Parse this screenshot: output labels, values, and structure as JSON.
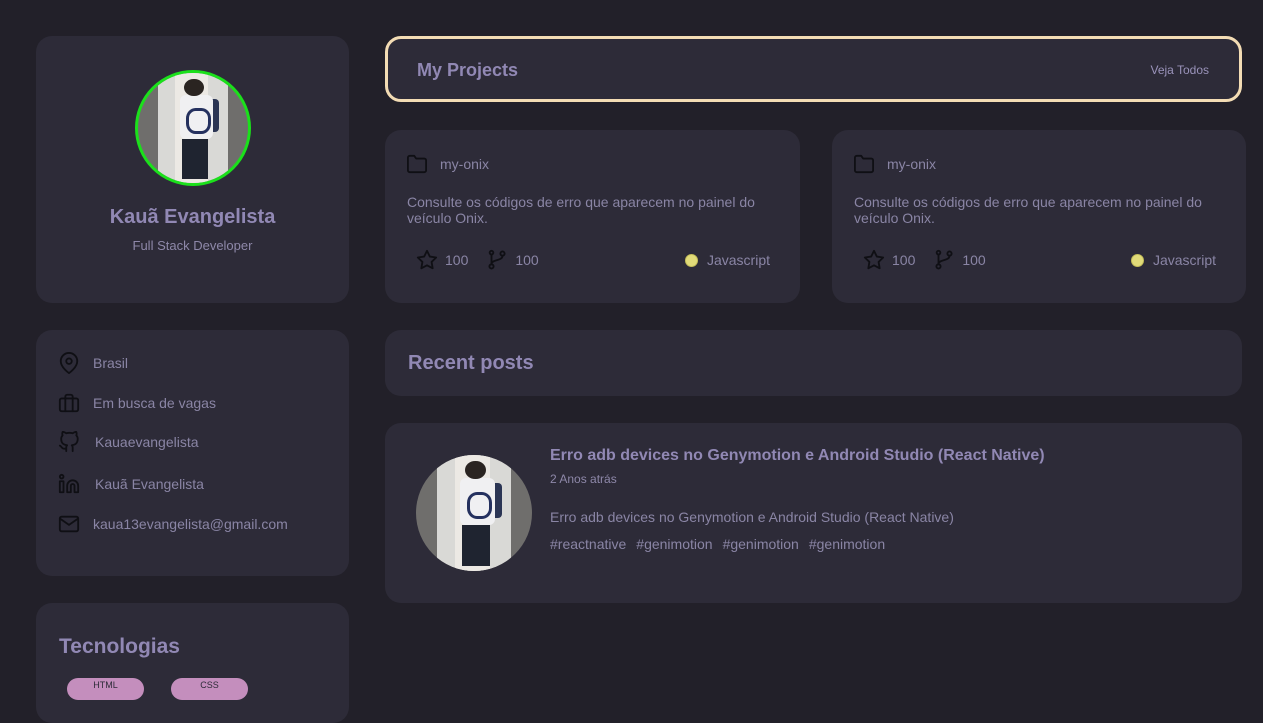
{
  "profile": {
    "name": "Kauã Evangelista",
    "role": "Full Stack Developer",
    "avatar_ring_color": "#1be01b"
  },
  "info": {
    "location": "Brasil",
    "job_status": "Em busca de vagas",
    "github": "Kauaevangelista",
    "linkedin": "Kauã Evangelista",
    "email": "kaua13evangelista@gmail.com"
  },
  "tech": {
    "title": "Tecnologias",
    "tags": [
      "HTML",
      "CSS"
    ],
    "tag_color": "#c48ebd"
  },
  "projects": {
    "title": "My Projects",
    "see_all": "Veja Todos",
    "border_color": "#f3dcb4",
    "items": [
      {
        "name": "my-onix",
        "description": "Consulte os códigos de erro que aparecem no painel do veículo Onix.",
        "stars": "100",
        "forks": "100",
        "language": "Javascript",
        "language_color": "#e1db79"
      },
      {
        "name": "my-onix",
        "description": "Consulte os códigos de erro que aparecem no painel do veículo Onix.",
        "stars": "100",
        "forks": "100",
        "language": "Javascript",
        "language_color": "#e1db79"
      }
    ]
  },
  "posts": {
    "title": "Recent posts",
    "items": [
      {
        "title": "Erro adb devices no Genymotion e Android Studio (React Native)",
        "time": "2 Anos atrás",
        "body": "Erro adb devices no Genymotion e Android Studio (React Native)",
        "tags": [
          "#reactnative",
          "#genimotion",
          "#genimotion",
          "#genimotion"
        ]
      }
    ]
  },
  "icons": {
    "location": "map-pin-icon",
    "job": "briefcase-icon",
    "github": "github-icon",
    "linkedin": "linkedin-icon",
    "email": "mail-icon",
    "folder": "folder-icon",
    "star": "star-icon",
    "fork": "git-fork-icon"
  }
}
